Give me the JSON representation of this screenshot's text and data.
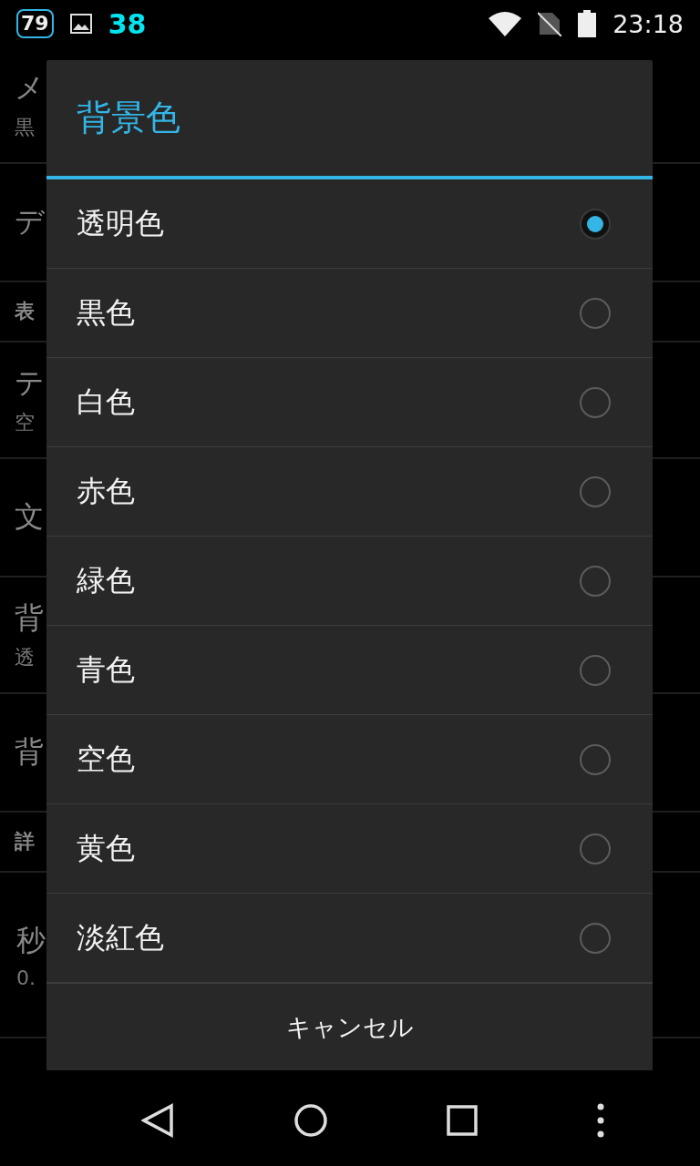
{
  "status_bar": {
    "badge": "79",
    "counter": "38",
    "time": "23:18"
  },
  "background_list": [
    {
      "kind": "item",
      "title": "メ",
      "summary": "黒"
    },
    {
      "kind": "item",
      "title": "デ"
    },
    {
      "kind": "category",
      "title": "表"
    },
    {
      "kind": "item",
      "title": "テ",
      "summary": "空"
    },
    {
      "kind": "item",
      "title": "文"
    },
    {
      "kind": "item",
      "title": "背",
      "summary": "透"
    },
    {
      "kind": "item",
      "title": "背"
    },
    {
      "kind": "category",
      "title": "詳"
    },
    {
      "kind": "indented",
      "title": "秒",
      "summary": "0."
    }
  ],
  "dialog": {
    "title": "背景色",
    "options": [
      {
        "label": "透明色",
        "selected": true
      },
      {
        "label": "黒色",
        "selected": false
      },
      {
        "label": "白色",
        "selected": false
      },
      {
        "label": "赤色",
        "selected": false
      },
      {
        "label": "緑色",
        "selected": false
      },
      {
        "label": "青色",
        "selected": false
      },
      {
        "label": "空色",
        "selected": false
      },
      {
        "label": "黄色",
        "selected": false
      },
      {
        "label": "淡紅色",
        "selected": false
      }
    ],
    "cancel": "キャンセル"
  }
}
